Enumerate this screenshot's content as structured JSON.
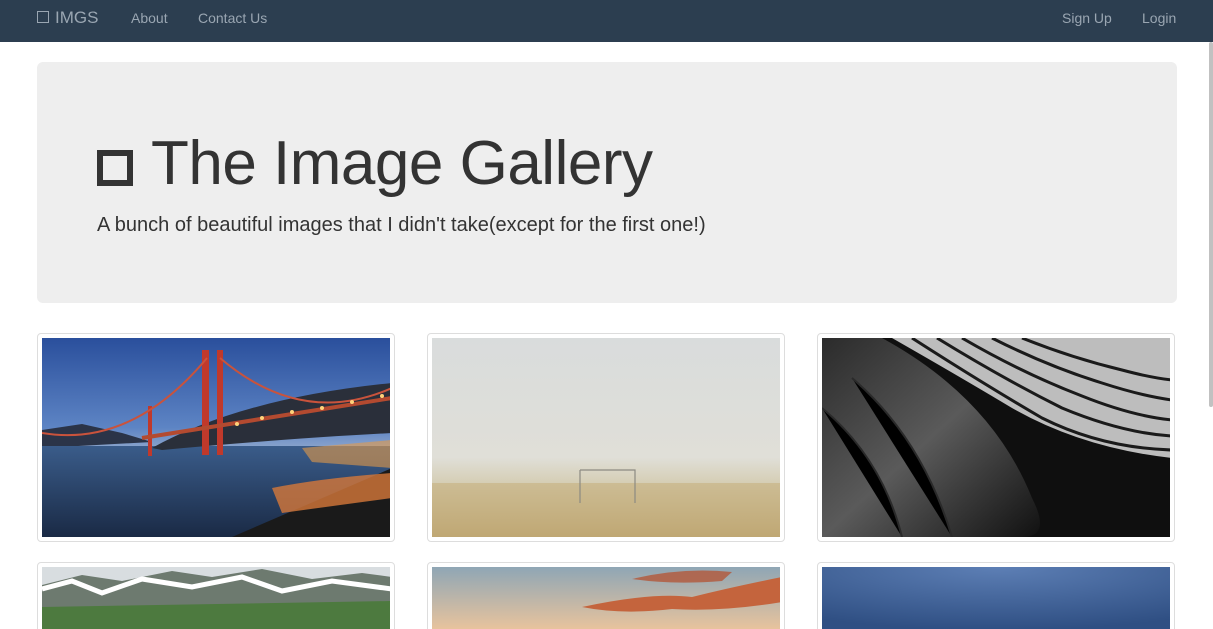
{
  "navbar": {
    "brand": "IMGS",
    "brand_icon": "square-outline-icon",
    "left_links": [
      "About",
      "Contact Us"
    ],
    "right_links": [
      "Sign Up",
      "Login"
    ]
  },
  "jumbotron": {
    "title": "The Image Gallery",
    "title_icon": "square-outline-icon",
    "subtitle": "A bunch of beautiful images that I didn't take(except for the first one!)"
  },
  "gallery": {
    "images": [
      {
        "subject": "golden-gate-bridge-night"
      },
      {
        "subject": "foggy-beach-soccer-goal"
      },
      {
        "subject": "abstract-monochrome-architecture"
      },
      {
        "subject": "snowy-green-mountains"
      },
      {
        "subject": "sunset-clouds"
      },
      {
        "subject": "blue-sky"
      }
    ]
  },
  "colors": {
    "navbar_bg": "#2c3e50",
    "jumbotron_bg": "#eeeeee",
    "text": "#333333"
  }
}
